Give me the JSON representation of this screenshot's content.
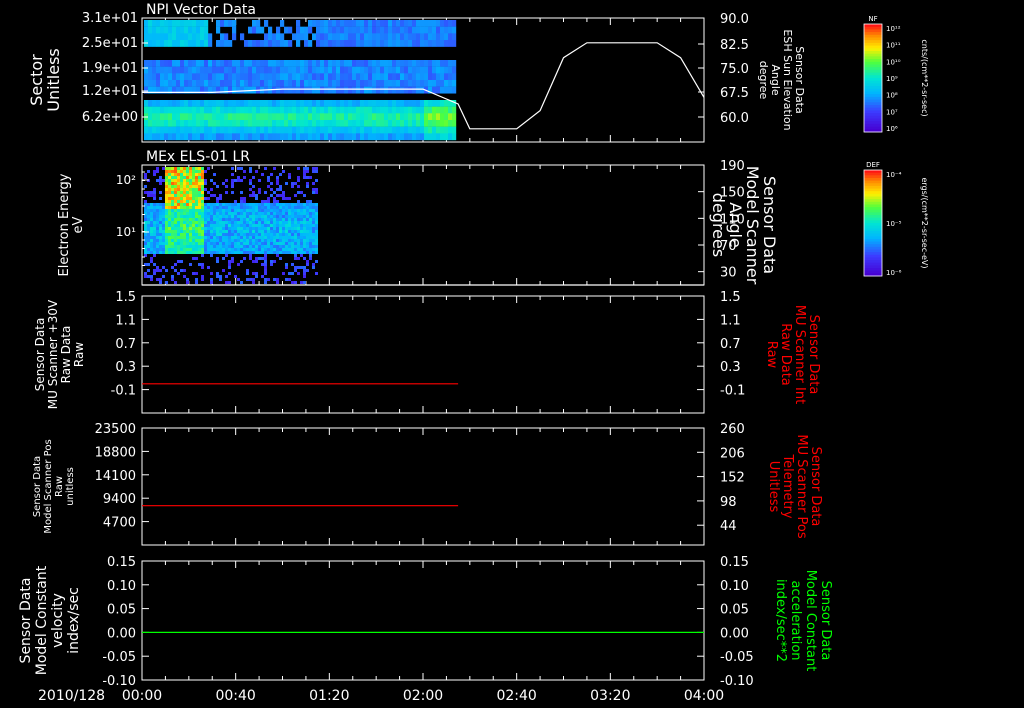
{
  "chart_data": [
    {
      "type": "heatmap",
      "title": "NPI Vector Data",
      "ylabel": [
        "Sector",
        "Unitless"
      ],
      "yticks": [
        "3.1e+01",
        "2.5e+01",
        "1.9e+01",
        "1.2e+01",
        "6.2e+00"
      ],
      "ylim": [
        0,
        31
      ],
      "right_axis": {
        "label": [
          "Sensor Data",
          "ESH Sun Elevation",
          "Angle",
          "degree"
        ],
        "ticks": [
          "90.0",
          "82.5",
          "75.0",
          "67.5",
          "60.0"
        ],
        "ylim": [
          52.5,
          90
        ],
        "series": {
          "name": "Sensor Data ESH Sun Elevation Angle",
          "color": "#ffffff",
          "x": [
            "00:00",
            "00:30",
            "01:00",
            "01:30",
            "02:00",
            "02:15",
            "02:20",
            "02:30",
            "02:40",
            "02:50",
            "03:00",
            "03:10",
            "03:20",
            "03:30",
            "03:40",
            "03:50",
            "04:00"
          ],
          "y": [
            67.5,
            67.5,
            68.5,
            68.5,
            68.5,
            64,
            56.5,
            56.5,
            56.5,
            62,
            78,
            82.5,
            82.5,
            82.5,
            82.5,
            78,
            66
          ]
        }
      },
      "colorbar": {
        "tag": "NF",
        "label": "cnts/(cm**2-sr-sec)",
        "ticks": [
          "10¹²",
          "10¹¹",
          "10¹⁰",
          "10⁹",
          "10⁸",
          "10⁷",
          "10⁶"
        ]
      }
    },
    {
      "type": "heatmap",
      "title": "MEx ELS-01 LR",
      "ylabel": [
        "Electron Energy",
        "eV"
      ],
      "yticks": [
        "10²",
        "10¹"
      ],
      "right_axis": {
        "label": [
          "Sensor Data",
          "Model Scanner",
          "Angle",
          "degrees"
        ],
        "ticks": [
          "190",
          "150",
          "110",
          "70",
          "30"
        ],
        "ylim": [
          10,
          190
        ],
        "series": {
          "name": "Sensor Data Model Scanner Angle",
          "color": "#ffffff",
          "x": [
            "00:00",
            "04:00"
          ],
          "y": [
            10,
            10
          ]
        }
      },
      "colorbar": {
        "tag": "DEF",
        "label": "ergs/(cm**2-sr-sec-eV)",
        "ticks": [
          "10⁻⁴",
          "10⁻⁵",
          "10⁻⁶"
        ]
      }
    },
    {
      "type": "line",
      "ylabel": [
        "Sensor Data",
        "MU Scanner +30V",
        "Raw Data",
        "Raw"
      ],
      "yticks": [
        "1.5",
        "1.1",
        "0.7",
        "0.3",
        "-0.1"
      ],
      "ylim": [
        -0.5,
        1.5
      ],
      "right_axis": {
        "label": [
          "Sensor Data",
          "MU Scanner Int",
          "Raw Data",
          "Raw"
        ],
        "label_color": "#ff0000",
        "ticks": [
          "1.5",
          "1.1",
          "0.7",
          "0.3",
          "-0.1"
        ],
        "ylim": [
          -0.5,
          1.5
        ]
      },
      "series": [
        {
          "color": "#ff0000",
          "x": [
            "00:00",
            "02:15"
          ],
          "y": [
            0.0,
            0.0
          ]
        }
      ]
    },
    {
      "type": "line",
      "ylabel": [
        "Sensor Data",
        "Model Scanner Pos",
        "Raw",
        "unitless"
      ],
      "yticks": [
        "23500",
        "18800",
        "14100",
        "9400",
        "4700"
      ],
      "ylim": [
        0,
        23500
      ],
      "right_axis": {
        "label": [
          "Sensor Data",
          "MU Scanner Pos",
          "Telemetry",
          "Unitless"
        ],
        "label_color": "#ff0000",
        "ticks": [
          "260",
          "206",
          "152",
          "98",
          "44"
        ],
        "ylim": [
          0,
          260
        ]
      },
      "series": [
        {
          "color": "#ff0000",
          "x": [
            "00:00",
            "02:15"
          ],
          "y": [
            7900,
            7900
          ]
        }
      ]
    },
    {
      "type": "line",
      "ylabel": [
        "Sensor Data",
        "Model Constant",
        "velocity",
        "index/sec"
      ],
      "yticks": [
        "0.15",
        "0.10",
        "0.05",
        "0.00",
        "-0.05",
        "-0.10"
      ],
      "ylim": [
        -0.1,
        0.15
      ],
      "right_axis": {
        "label": [
          "Sensor Data",
          "Model Constant",
          "acceleration",
          "index/sec**2"
        ],
        "label_color": "#00ff00",
        "ticks": [
          "0.15",
          "0.10",
          "0.05",
          "0.00",
          "-0.05",
          "-0.10"
        ],
        "ylim": [
          -0.1,
          0.15
        ]
      },
      "series": [
        {
          "color": "#00ff00",
          "x": [
            "00:00",
            "04:00"
          ],
          "y": [
            0.0,
            0.0
          ]
        }
      ]
    }
  ],
  "xaxis": {
    "date_label": "2010/128",
    "ticks": [
      "00:00",
      "00:40",
      "01:20",
      "02:00",
      "02:40",
      "03:20",
      "04:00"
    ]
  }
}
